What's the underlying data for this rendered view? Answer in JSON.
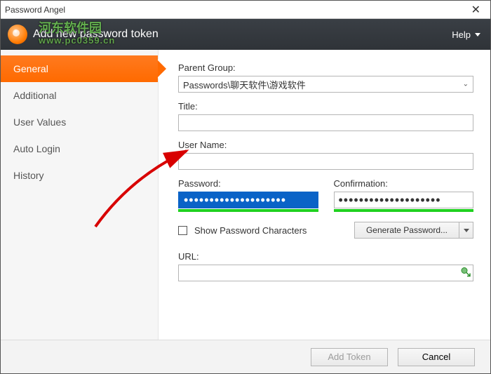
{
  "window": {
    "title": "Password Angel"
  },
  "header": {
    "title": "Add new password token",
    "watermark_line1": "河东软件园",
    "watermark_line2": "www.pc0359.cn",
    "help_label": "Help"
  },
  "sidebar": {
    "tabs": [
      {
        "label": "General",
        "active": true
      },
      {
        "label": "Additional",
        "active": false
      },
      {
        "label": "User Values",
        "active": false
      },
      {
        "label": "Auto Login",
        "active": false
      },
      {
        "label": "History",
        "active": false
      }
    ]
  },
  "form": {
    "parent_group_label": "Parent Group:",
    "parent_group_value": "Passwords\\聊天软件\\游戏软件",
    "title_label": "Title:",
    "title_value": "",
    "username_label": "User Name:",
    "username_value": "",
    "password_label": "Password:",
    "password_value": "••••••••••••••••••••",
    "confirmation_label": "Confirmation:",
    "confirmation_value": "••••••••••••••••••••",
    "show_pw_label": "Show Password Characters",
    "generate_label": "Generate Password...",
    "url_label": "URL:",
    "url_value": ""
  },
  "footer": {
    "add_label": "Add Token",
    "cancel_label": "Cancel"
  }
}
